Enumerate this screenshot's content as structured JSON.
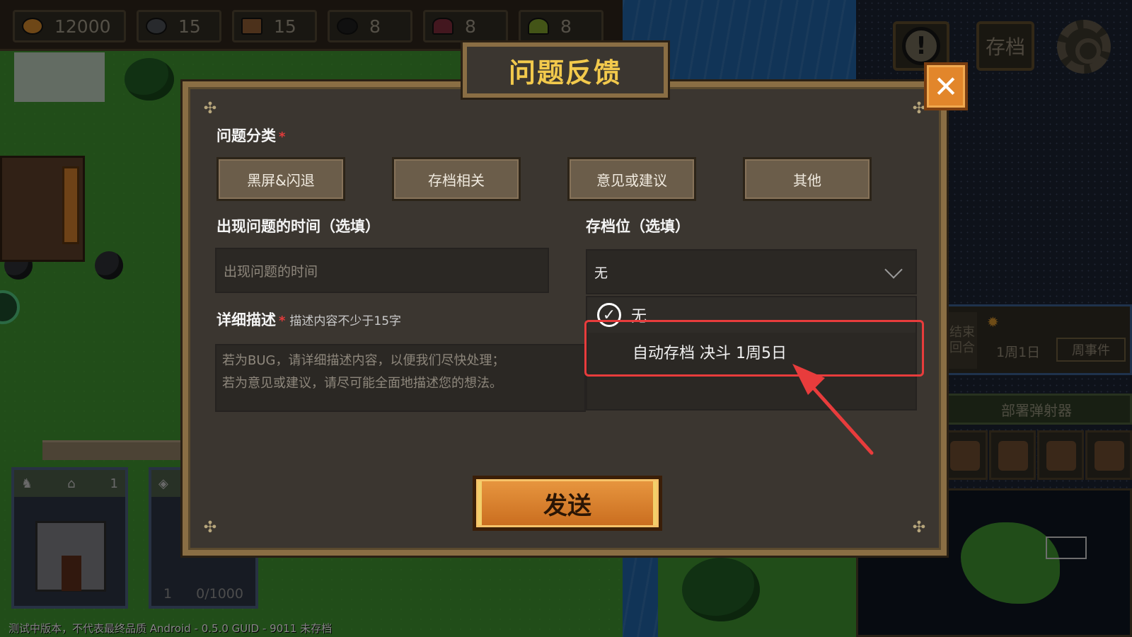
{
  "resources": [
    {
      "icon": "gold-ore-icon",
      "value": "12000",
      "color": "#c9822a"
    },
    {
      "icon": "stone-icon",
      "value": "15",
      "color": "#4a4d52"
    },
    {
      "icon": "wood-icon",
      "value": "15",
      "color": "#8a5a32"
    },
    {
      "icon": "coal-icon",
      "value": "8",
      "color": "#1e1e1e"
    },
    {
      "icon": "crystal-icon",
      "value": "8",
      "color": "#7a2a3a"
    },
    {
      "icon": "herb-icon",
      "value": "8",
      "color": "#7a9a2a"
    }
  ],
  "topbar": {
    "save_label": "存档"
  },
  "turn": {
    "end_turn": "结束回合",
    "date": "1周1日",
    "week_event": "周事件"
  },
  "side": {
    "deploy": "部署弹射器"
  },
  "cards": {
    "card1_count": "1",
    "card2_level": "1",
    "card2_capacity": "0/1000"
  },
  "status": "测试中版本，不代表最终品质   Android - 0.5.0   GUID - 9011   未存档",
  "dialog": {
    "title": "问题反馈",
    "category_label": "问题分类",
    "categories": [
      "黑屏&闪退",
      "存档相关",
      "意见或建议",
      "其他"
    ],
    "time_label": "出现问题的时间（选填）",
    "time_placeholder": "出现问题的时间",
    "slot_label": "存档位（选填）",
    "slot_selected": "无",
    "slot_options": [
      "无",
      "自动存档 决斗 1周5日"
    ],
    "detail_label": "详细描述",
    "detail_hint": "描述内容不少于15字",
    "detail_placeholder_line1": "若为BUG，请详细描述内容，以便我们尽快处理；",
    "detail_placeholder_line2": "若为意见或建议，请尽可能全面地描述您的想法。",
    "send_label": "发送"
  },
  "colors": {
    "accent": "#f2c94c",
    "highlight": "#e83c3c",
    "send": "#e08a34"
  }
}
